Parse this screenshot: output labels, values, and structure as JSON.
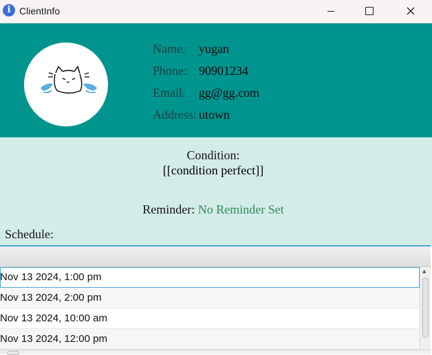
{
  "window": {
    "title": "ClientInfo",
    "icon": "info-icon",
    "controls": [
      "minimize",
      "maximize",
      "close"
    ]
  },
  "client": {
    "avatar_icon": "crying-cat-icon",
    "fields": [
      {
        "label": "Name:",
        "value": "yugan"
      },
      {
        "label": "Phone:",
        "value": "90901234"
      },
      {
        "label": "Email:",
        "value": "gg@gg.com"
      },
      {
        "label": "Address:",
        "value": "utown"
      }
    ]
  },
  "condition": {
    "label": "Condition:",
    "value": "[[condition perfect]]"
  },
  "reminder": {
    "label": "Reminder:",
    "value": "No Reminder Set"
  },
  "schedule": {
    "label": "Schedule:",
    "items": [
      "Nov 13 2024, 1:00 pm",
      "Nov 13 2024, 2:00 pm",
      "Nov 13 2024, 10:00 am",
      "Nov 13 2024, 12:00 pm"
    ]
  },
  "colors": {
    "header_bg": "#00948f",
    "body_bg": "#d4ece8",
    "reminder_value": "#2e8b57",
    "selection": "#4aa8d8"
  }
}
